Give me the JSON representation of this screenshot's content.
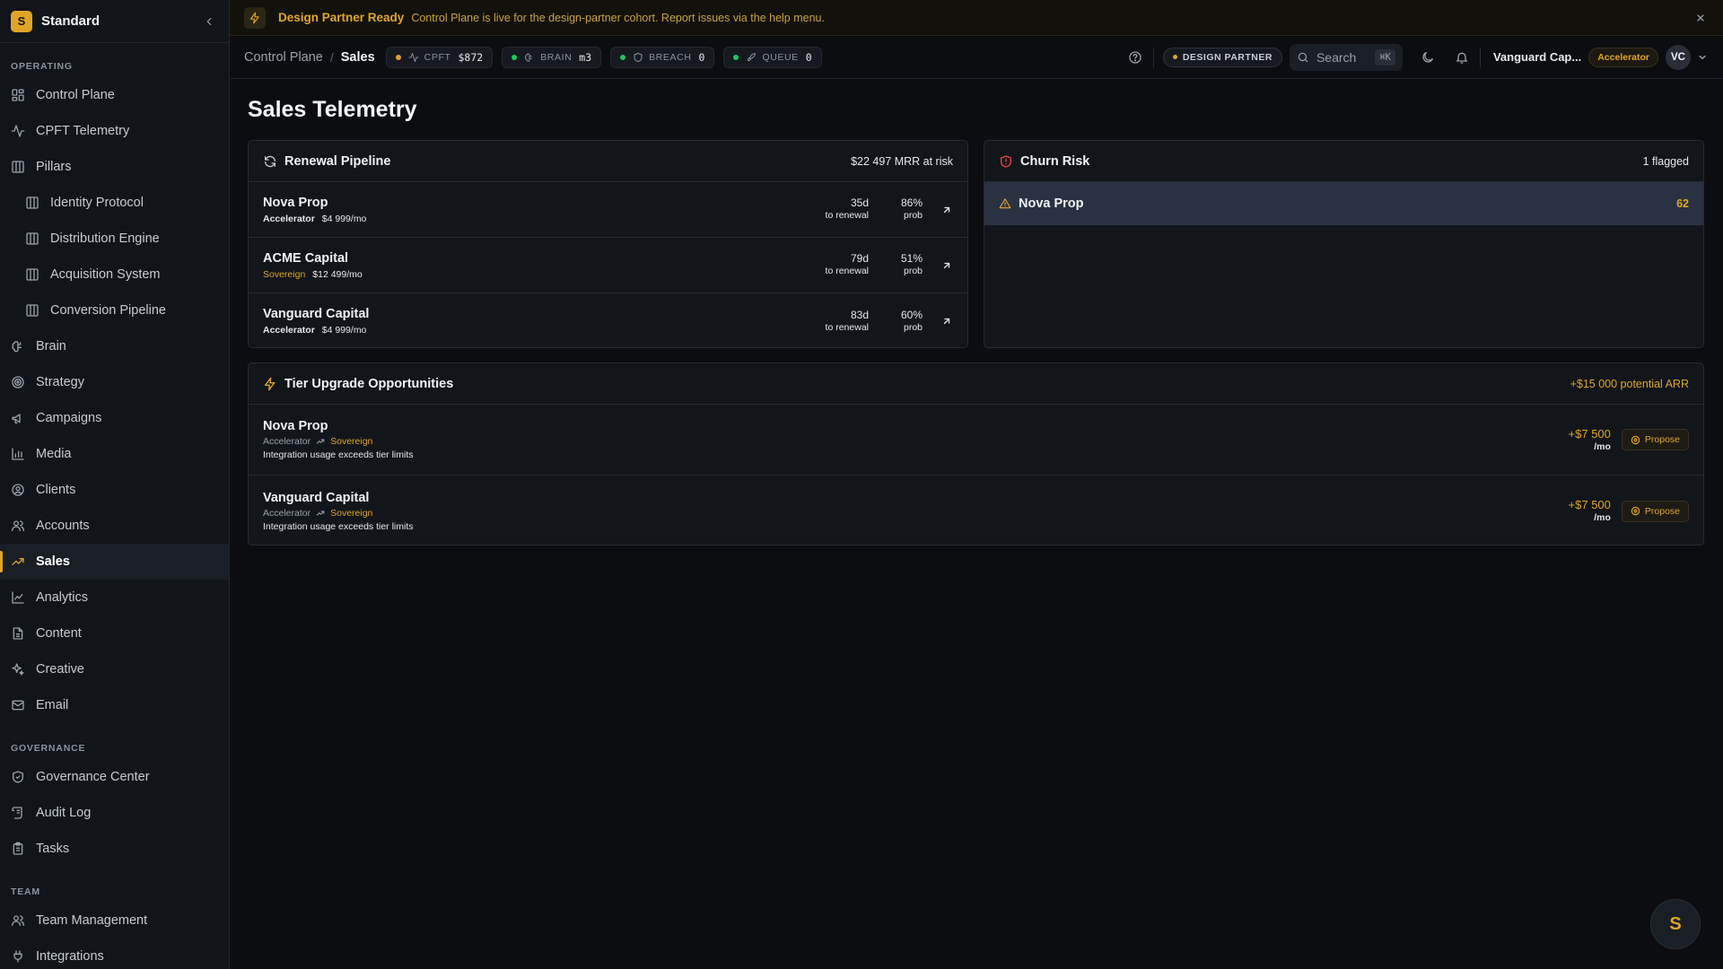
{
  "sidebar": {
    "logo_letter": "S",
    "workspace": "Standard",
    "sections": [
      {
        "label": "OPERATING"
      },
      {
        "label": "GOVERNANCE"
      },
      {
        "label": "TEAM"
      }
    ],
    "items": [
      {
        "label": "Control Plane"
      },
      {
        "label": "CPFT Telemetry"
      },
      {
        "label": "Pillars"
      },
      {
        "label": "Identity Protocol"
      },
      {
        "label": "Distribution Engine"
      },
      {
        "label": "Acquisition System"
      },
      {
        "label": "Conversion Pipeline"
      },
      {
        "label": "Brain"
      },
      {
        "label": "Strategy"
      },
      {
        "label": "Campaigns"
      },
      {
        "label": "Media"
      },
      {
        "label": "Clients"
      },
      {
        "label": "Accounts"
      },
      {
        "label": "Sales"
      },
      {
        "label": "Analytics"
      },
      {
        "label": "Content"
      },
      {
        "label": "Creative"
      },
      {
        "label": "Email"
      },
      {
        "label": "Governance Center"
      },
      {
        "label": "Audit Log"
      },
      {
        "label": "Tasks"
      },
      {
        "label": "Team Management"
      },
      {
        "label": "Integrations"
      }
    ],
    "active": "Sales"
  },
  "banner": {
    "title": "Design Partner Ready",
    "message": "Control Plane is live for the design-partner cohort. Report issues via the help menu."
  },
  "header": {
    "breadcrumb": [
      "Control Plane",
      "Sales"
    ],
    "pills": [
      {
        "label": "CPFT",
        "value": "$872",
        "dot": "#e0a526"
      },
      {
        "label": "BRAIN",
        "value": "m3",
        "dot": "#22c55e"
      },
      {
        "label": "BREACH",
        "value": "0",
        "dot": "#22c55e"
      },
      {
        "label": "QUEUE",
        "value": "0",
        "dot": "#22c55e"
      }
    ],
    "design_partner_badge": "DESIGN PARTNER",
    "search_label": "Search",
    "search_shortcut": "⌘K",
    "org_name": "Vanguard Cap...",
    "org_tier": "Accelerator",
    "avatar_initials": "VC"
  },
  "page": {
    "title": "Sales Telemetry"
  },
  "renewal": {
    "title": "Renewal Pipeline",
    "meta": "$22 497 MRR at risk",
    "rows": [
      {
        "name": "Nova Prop",
        "tier": "Accelerator",
        "tier_gold": false,
        "mrr": "$4 999/mo",
        "days": "35d",
        "days_label": "to renewal",
        "prob": "86%",
        "prob_label": "prob"
      },
      {
        "name": "ACME Capital",
        "tier": "Sovereign",
        "tier_gold": true,
        "mrr": "$12 499/mo",
        "days": "79d",
        "days_label": "to renewal",
        "prob": "51%",
        "prob_label": "prob"
      },
      {
        "name": "Vanguard Capital",
        "tier": "Accelerator",
        "tier_gold": false,
        "mrr": "$4 999/mo",
        "days": "83d",
        "days_label": "to renewal",
        "prob": "60%",
        "prob_label": "prob"
      }
    ]
  },
  "churn": {
    "title": "Churn Risk",
    "meta": "1 flagged",
    "rows": [
      {
        "name": "Nova Prop",
        "score": "62"
      }
    ]
  },
  "upgrades": {
    "title": "Tier Upgrade Opportunities",
    "meta": "+$15 000 potential ARR",
    "rows": [
      {
        "name": "Nova Prop",
        "from": "Accelerator",
        "to": "Sovereign",
        "reason": "Integration usage exceeds tier limits",
        "amount": "+$7 500",
        "per": "/mo",
        "action": "Propose"
      },
      {
        "name": "Vanguard Capital",
        "from": "Accelerator",
        "to": "Sovereign",
        "reason": "Integration usage exceeds tier limits",
        "amount": "+$7 500",
        "per": "/mo",
        "action": "Propose"
      }
    ]
  },
  "fab_letter": "S",
  "colors": {
    "accent": "#e0a526",
    "background": "#0b0d10",
    "panel": "#12151a",
    "highlight_row": "#293240",
    "danger": "#ef4444",
    "ok": "#22c55e"
  }
}
